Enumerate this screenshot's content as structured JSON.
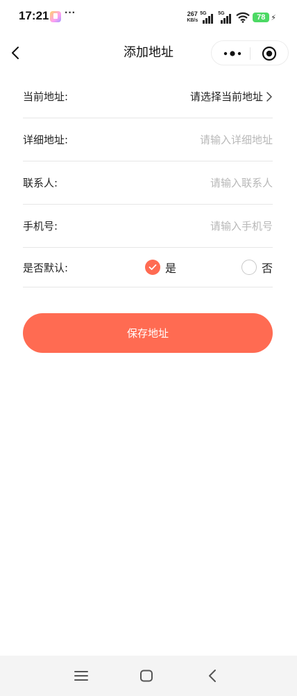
{
  "status_bar": {
    "time": "17:21",
    "dots": "···",
    "net_speed": "267",
    "net_unit": "KB/s",
    "signal_1": "5G",
    "signal_2": "5G",
    "battery": "78"
  },
  "header": {
    "title": "添加地址",
    "back_icon": "chevron-left-icon",
    "more_icon": "more-dots-icon",
    "close_icon": "target-close-icon"
  },
  "form": {
    "current_address": {
      "label": "当前地址:",
      "value": "请选择当前地址"
    },
    "detail_address": {
      "label": "详细地址:",
      "value": "",
      "placeholder": "请输入详细地址"
    },
    "contact": {
      "label": "联系人:",
      "value": "",
      "placeholder": "请输入联系人"
    },
    "phone": {
      "label": "手机号:",
      "value": "",
      "placeholder": "请输入手机号"
    },
    "is_default": {
      "label": "是否默认:",
      "options": [
        {
          "label": "是",
          "selected": true
        },
        {
          "label": "否",
          "selected": false
        }
      ]
    }
  },
  "save_button": {
    "label": "保存地址"
  },
  "colors": {
    "accent": "#ff6b52",
    "placeholder": "#b8b8b8",
    "divider": "#e6e6e6",
    "battery": "#4cd964"
  },
  "system_nav": {
    "menu_icon": "menu-lines-icon",
    "home_icon": "home-square-icon",
    "back_icon": "back-triangle-icon"
  }
}
